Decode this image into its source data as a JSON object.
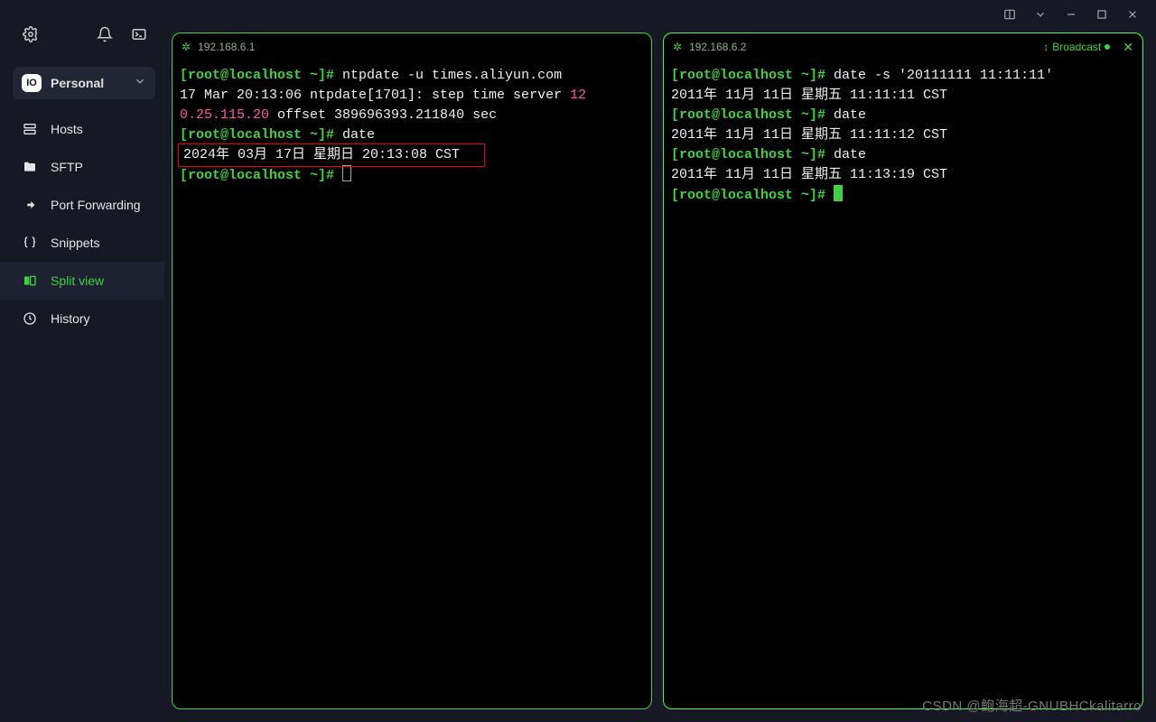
{
  "workspace": {
    "badge": "IO",
    "label": "Personal"
  },
  "sidebar": {
    "items": [
      {
        "label": "Hosts"
      },
      {
        "label": "SFTP"
      },
      {
        "label": "Port Forwarding"
      },
      {
        "label": "Snippets"
      },
      {
        "label": "Split view"
      },
      {
        "label": "History"
      }
    ]
  },
  "panes": {
    "left": {
      "host": "192.168.6.1",
      "l1_prompt": "[root@localhost ~]# ",
      "l1_cmd": "ntpdate -u times.aliyun.com",
      "l2a": "17 Mar 20:13:06 ntpdate[1701]: step time server ",
      "l2b": "12",
      "l3a": "0.25.115.20",
      "l3b": " offset 389696393.211840 sec",
      "l4_prompt": "[root@localhost ~]# ",
      "l4_cmd": "date",
      "l5": "2024年 03月 17日 星期日 20:13:08 CST",
      "l6_prompt": "[root@localhost ~]# "
    },
    "right": {
      "host": "192.168.6.2",
      "broadcast": "Broadcast",
      "l1_prompt": "[root@localhost ~]# ",
      "l1_cmd": "date -s '20111111 11:11:11'",
      "l2": "2011年 11月 11日 星期五 11:11:11 CST",
      "l3_prompt": "[root@localhost ~]# ",
      "l3_cmd": "date",
      "l4": "2011年 11月 11日 星期五 11:11:12 CST",
      "l5_prompt": "[root@localhost ~]# ",
      "l5_cmd": "date",
      "l6": "2011年 11月 11日 星期五 11:13:19 CST",
      "l7_prompt": "[root@localhost ~]# "
    }
  },
  "watermark": "CSDN @鲍海超-GNUBHCkalitarro"
}
